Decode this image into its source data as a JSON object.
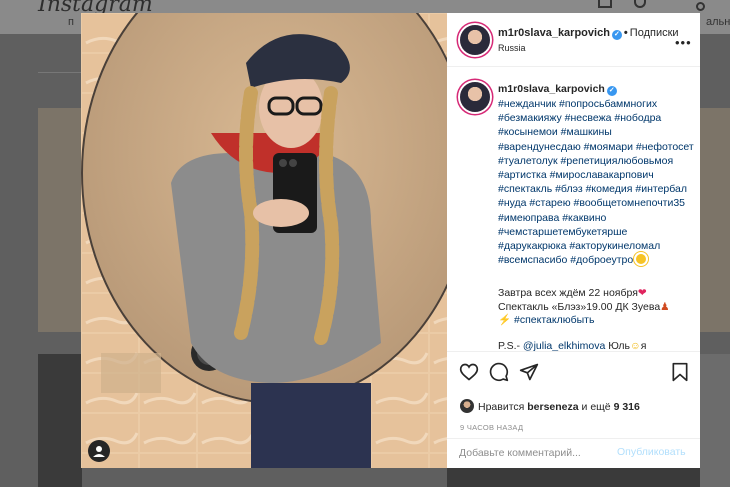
{
  "background": {
    "logo": "Instagram",
    "nav_left": "п",
    "nav_right": "альное"
  },
  "post": {
    "header": {
      "username": "m1r0slava_karpovich",
      "follow_label": "Подписки",
      "location": "Russia"
    },
    "caption": {
      "username": "m1r0slava_karpovich",
      "hashtags": "#нежданчик #попросьбаммногих #безмакияжу #несвежа #нободра #косынемои #машкины #варендунесдаю #моямари #нефотосет #туалетолук #репетициялюбовьмоя #артистка #мирославакарпович #спектакль #блэз #комедия #интербал #нуда #старею #вообщетомнепочти35 #имеюправа #каквино #чемстаршетембукетярше #дарукакрюка #акторукинеломал #всемспасибо #доброеутро",
      "line1": "Завтра всех ждём 22 ноября",
      "line2": "Спектакль «Блэз»19.00 ДК Зуева",
      "line3": "#спектаклюбыть",
      "ps_prefix": "P.S.- ",
      "ps_mention": "@julia_elkhimova",
      "ps_rest": " Юль",
      "ps_rest2": "я запуталась,не решила Тебе тоже..."
    },
    "likes": {
      "prefix": "Нравится ",
      "user": "berseneza",
      "middle": " и ещё ",
      "count": "9 316"
    },
    "time": "9 ЧАСОВ НАЗАД",
    "comment": {
      "placeholder": "Добавьте комментарий...",
      "publish_label": "Опубликовать"
    }
  },
  "colors": {
    "accent": "#3897f0",
    "link": "#00376b",
    "publish_disabled": "#b2dffc"
  },
  "icons": [
    "heart-icon",
    "comment-icon",
    "share-icon",
    "bookmark-icon",
    "more-icon",
    "verified-icon",
    "user-tag-icon"
  ]
}
